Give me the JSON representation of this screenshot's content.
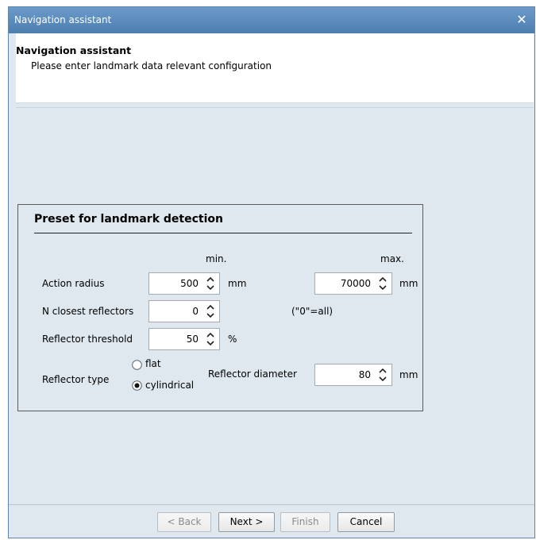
{
  "window": {
    "title": "Navigation assistant"
  },
  "header": {
    "title": "Navigation assistant",
    "subtitle": "Please enter landmark data relevant configuration"
  },
  "panel": {
    "title": "Preset for landmark detection",
    "col_min": "min.",
    "col_max": "max.",
    "action_radius": {
      "label": "Action radius",
      "min": "500",
      "min_unit": "mm",
      "max": "70000",
      "max_unit": "mm"
    },
    "n_closest": {
      "label": "N closest reflectors",
      "value": "0",
      "hint": "(\"0\"=all)"
    },
    "threshold": {
      "label": "Reflector threshold",
      "value": "50",
      "unit": "%"
    },
    "reflector_type": {
      "label": "Reflector type",
      "options": [
        "flat",
        "cylindrical"
      ],
      "selected": "cylindrical"
    },
    "diameter": {
      "label": "Reflector diameter",
      "value": "80",
      "unit": "mm"
    }
  },
  "buttons": {
    "back": "< Back",
    "next": "Next >",
    "finish": "Finish",
    "cancel": "Cancel"
  }
}
